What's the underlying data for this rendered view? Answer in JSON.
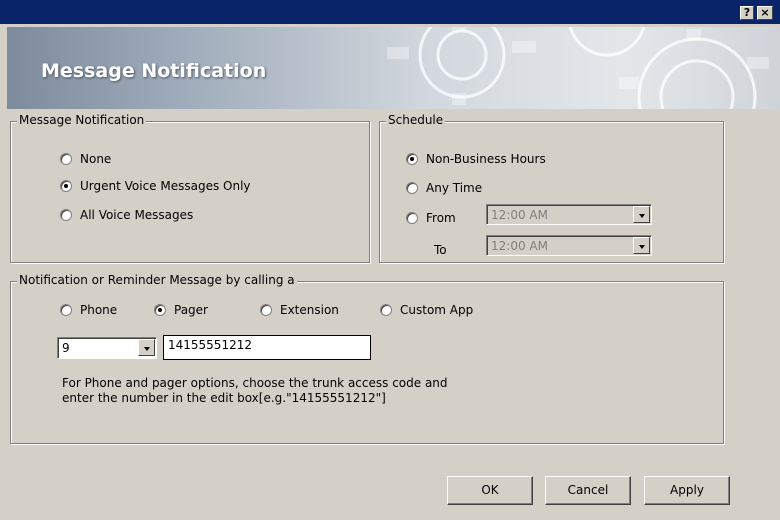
{
  "titlebar": {
    "help_label": "?",
    "close_label": "×"
  },
  "banner": {
    "title": "Message Notification"
  },
  "message_notification": {
    "legend": "Message Notification",
    "options": [
      {
        "label": "None",
        "selected": false
      },
      {
        "label": "Urgent Voice Messages Only",
        "selected": true
      },
      {
        "label": "All Voice Messages",
        "selected": false
      }
    ]
  },
  "schedule": {
    "legend": "Schedule",
    "options": [
      {
        "label": "Non-Business Hours",
        "selected": true
      },
      {
        "label": "Any Time",
        "selected": false
      },
      {
        "label": "From",
        "selected": false
      }
    ],
    "from_value": "12:00 AM",
    "to_label": "To",
    "to_value": "12:00 AM"
  },
  "notification": {
    "legend": "Notification or Reminder Message  by calling a",
    "options": [
      {
        "label": "Phone",
        "selected": false
      },
      {
        "label": "Pager",
        "selected": true
      },
      {
        "label": "Extension",
        "selected": false
      },
      {
        "label": "Custom App",
        "selected": false
      }
    ],
    "trunk_code": "9",
    "number": "14155551212",
    "hint_line1": "For Phone and pager options, choose the trunk access code and",
    "hint_line2": "enter the number in the edit box[e.g.\"14155551212\"]"
  },
  "buttons": {
    "ok": "OK",
    "cancel": "Cancel",
    "apply": "Apply"
  }
}
